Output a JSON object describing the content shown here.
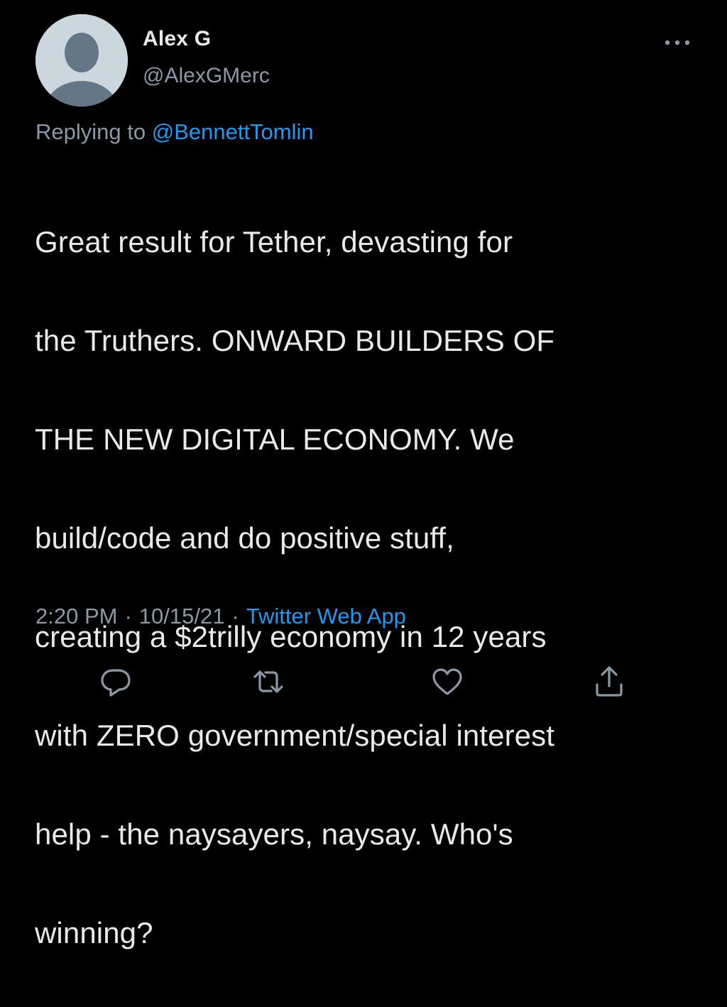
{
  "tweet": {
    "author": {
      "display_name": "Alex G",
      "handle": "@AlexGMerc",
      "avatar_icon": "default-avatar-icon"
    },
    "more_icon": "more-options-icon",
    "replying_to": {
      "prefix": "Replying to ",
      "mention": "@BennettTomlin"
    },
    "lines": [
      "Great result for Tether, devasting for",
      "the Truthers. ONWARD BUILDERS OF",
      "THE NEW DIGITAL ECONOMY. We",
      "build/code and do positive stuff,",
      "creating a $2trilly economy in 12 years",
      "with ZERO government/special interest",
      "help - the naysayers, naysay. Who's",
      "winning?"
    ],
    "meta": {
      "time": "2:20 PM",
      "separator": "·",
      "date": "10/15/21",
      "source": "Twitter Web App"
    },
    "actions": [
      "reply-icon",
      "retweet-icon",
      "like-icon",
      "share-icon"
    ]
  },
  "colors": {
    "background": "#000000",
    "primary_text": "#e7e9ea",
    "secondary_text": "#8b98a5",
    "accent": "#1d9bf0",
    "avatar_bg": "#ccd6dd",
    "avatar_fg": "#657786"
  }
}
